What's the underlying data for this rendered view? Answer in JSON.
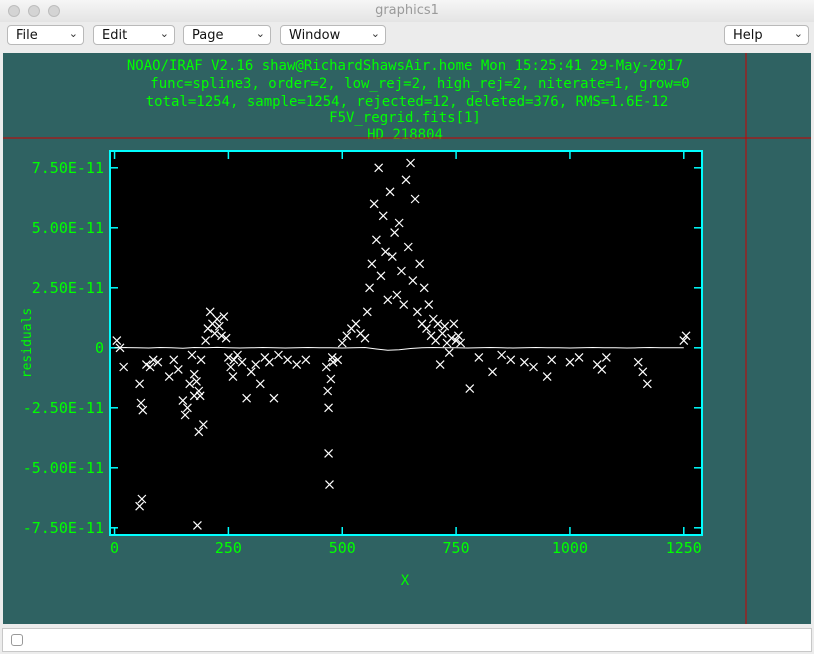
{
  "window": {
    "title": "graphics1"
  },
  "menus": {
    "file": "File",
    "edit": "Edit",
    "page": "Page",
    "window": "Window",
    "help": "Help"
  },
  "plot": {
    "header_lines": [
      "NOAO/IRAF V2.16 shaw@RichardShawsAir.home Mon 15:25:41 29-May-2017",
      "func=spline3, order=2, low_rej=2, high_rej=2, niterate=1, grow=0",
      "total=1254, sample=1254, rejected=12, deleted=376, RMS=1.6E-12",
      "F5V_regrid.fits[1]",
      "HD 218804"
    ],
    "xlabel": "X",
    "ylabel": "residuals",
    "colors": {
      "background": "#000000",
      "frame": "#2f6262",
      "axes": "#00ffff",
      "text": "#00ff00",
      "data": "#ffffff",
      "cursor": "#cc0000"
    }
  },
  "chart_data": {
    "type": "scatter",
    "xlabel": "X",
    "ylabel": "residuals",
    "xlim": [
      -10,
      1290
    ],
    "ylim": [
      -7.8e-11,
      8.2e-11
    ],
    "x_ticks": [
      0,
      250,
      500,
      750,
      1000,
      1250
    ],
    "x_tick_labels": [
      "0",
      "250",
      "500",
      "750",
      "1000",
      "1250"
    ],
    "y_ticks": [
      7.5e-11,
      5e-11,
      2.5e-11,
      0,
      -2.5e-11,
      -5e-11,
      -7.5e-11
    ],
    "y_tick_labels": [
      "7.50E-11",
      "5.00E-11",
      "2.50E-11",
      "0",
      "-2.50E-11",
      "-5.00E-11",
      "-7.50E-11"
    ],
    "series": [
      {
        "marker": "line",
        "x": [
          0,
          25,
          50,
          75,
          100,
          125,
          150,
          175,
          200,
          225,
          250,
          275,
          300,
          325,
          350,
          375,
          400,
          425,
          450,
          475,
          500,
          525,
          550,
          575,
          600,
          625,
          650,
          675,
          700,
          725,
          750,
          775,
          800,
          825,
          850,
          875,
          900,
          925,
          950,
          975,
          1000,
          1025,
          1050,
          1075,
          1100,
          1125,
          1150,
          1175,
          1200,
          1225,
          1250
        ],
        "y": [
          0.0,
          1e-13,
          0.0,
          -1e-13,
          1e-13,
          0.0,
          -2e-13,
          1e-13,
          0.0,
          2e-13,
          0.0,
          -1e-13,
          0.0,
          1e-13,
          0.0,
          -1e-13,
          0.0,
          1e-13,
          0.0,
          0.0,
          -1e-13,
          0.0,
          1e-13,
          -5e-13,
          -1e-12,
          -8e-13,
          -3e-13,
          0.0,
          1e-13,
          0.0,
          0.0,
          -1e-13,
          0.0,
          1e-13,
          0.0,
          -1e-13,
          0.0,
          1e-13,
          0.0,
          0.0,
          -1e-13,
          0.0,
          1e-13,
          0.0,
          0.0,
          -1e-13,
          0.0,
          1e-13,
          0.0,
          0.0,
          0.0
        ]
      },
      {
        "marker": "x",
        "x": [
          5,
          12,
          20,
          55,
          58,
          62,
          60,
          55,
          70,
          78,
          85,
          95,
          120,
          130,
          140,
          150,
          155,
          160,
          170,
          175,
          180,
          185,
          190,
          195,
          165,
          175,
          185,
          188,
          182,
          200,
          205,
          210,
          215,
          220,
          225,
          230,
          235,
          240,
          245,
          250,
          255,
          260,
          262,
          270,
          280,
          290,
          300,
          310,
          320,
          330,
          340,
          350,
          360,
          380,
          400,
          420,
          465,
          468,
          470,
          470,
          472,
          475,
          478,
          480,
          490,
          500,
          510,
          520,
          530,
          540,
          550,
          555,
          560,
          565,
          570,
          575,
          580,
          585,
          590,
          595,
          600,
          605,
          610,
          615,
          620,
          625,
          630,
          635,
          640,
          645,
          650,
          655,
          660,
          665,
          670,
          675,
          680,
          685,
          690,
          695,
          700,
          705,
          710,
          715,
          720,
          725,
          730,
          735,
          740,
          745,
          750,
          755,
          760,
          780,
          800,
          830,
          850,
          870,
          900,
          920,
          950,
          960,
          1000,
          1020,
          1060,
          1070,
          1080,
          1150,
          1160,
          1170,
          1250,
          1255
        ],
        "y": [
          3e-12,
          0,
          -8e-12,
          -1.5e-11,
          -2.3e-11,
          -2.6e-11,
          -6.3e-11,
          -6.6e-11,
          -7e-12,
          -8e-12,
          -5e-12,
          -6e-12,
          -1.2e-11,
          -5e-12,
          -9e-12,
          -2.2e-11,
          -2.8e-11,
          -2.5e-11,
          -3e-12,
          -1.1e-11,
          -1.4e-11,
          -1.8e-11,
          -5e-12,
          -3.2e-11,
          -1.5e-11,
          -2e-11,
          -3.5e-11,
          -2e-11,
          -7.4e-11,
          3e-12,
          8e-12,
          1.5e-11,
          1e-11,
          6e-12,
          1.2e-11,
          9e-12,
          5e-12,
          1.3e-11,
          4e-12,
          -4e-12,
          -8e-12,
          -1.2e-11,
          -5e-12,
          -3e-12,
          -6e-12,
          -2.1e-11,
          -1e-11,
          -7e-12,
          -1.5e-11,
          -4e-12,
          -6e-12,
          -2.1e-11,
          -3e-12,
          -5e-12,
          -7e-12,
          -5e-12,
          -8e-12,
          -1.8e-11,
          -2.5e-11,
          -4.4e-11,
          -5.7e-11,
          -1.3e-11,
          -4e-12,
          -6e-12,
          -5e-12,
          2e-12,
          5e-12,
          8e-12,
          1e-11,
          6e-12,
          4e-12,
          1.5e-11,
          2.5e-11,
          3.5e-11,
          6e-11,
          4.5e-11,
          7.5e-11,
          3e-11,
          5.5e-11,
          4e-11,
          2e-11,
          6.5e-11,
          3.8e-11,
          4.8e-11,
          2.2e-11,
          5.2e-11,
          3.2e-11,
          1.8e-11,
          7e-11,
          4.2e-11,
          7.7e-11,
          2.8e-11,
          6.2e-11,
          1.5e-11,
          3.5e-11,
          1e-11,
          2.5e-11,
          8e-12,
          1.8e-11,
          5e-12,
          1.2e-11,
          3e-12,
          1e-11,
          -7e-12,
          6e-12,
          9e-12,
          2e-12,
          -2e-12,
          4e-12,
          1e-11,
          3e-12,
          5e-12,
          2e-12,
          -1.7e-11,
          -4e-12,
          -1e-11,
          -3e-12,
          -5e-12,
          -6e-12,
          -8e-12,
          -1.2e-11,
          -5e-12,
          -6e-12,
          -4e-12,
          -7e-12,
          -9e-12,
          -4e-12,
          -6e-12,
          -1e-11,
          -1.5e-11,
          3e-12,
          5e-12
        ]
      }
    ]
  }
}
